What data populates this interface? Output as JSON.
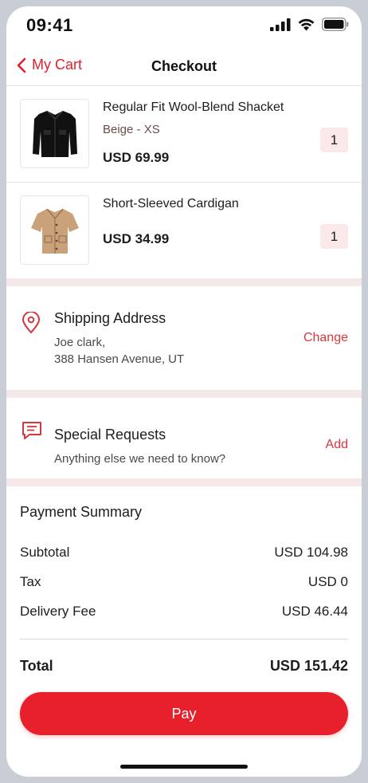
{
  "status_bar": {
    "time": "09:41",
    "icons": [
      "signal-icon",
      "wifi-icon",
      "battery-icon"
    ]
  },
  "nav": {
    "back_label": "My Cart",
    "title": "Checkout"
  },
  "items": [
    {
      "name": "Regular Fit Wool-Blend Shacket",
      "variant": "Beige - XS",
      "price": "USD 69.99",
      "qty": "1",
      "image": "black-jacket-image"
    },
    {
      "name": "Short-Sleeved Cardigan",
      "price": "USD 34.99",
      "qty": "1",
      "image": "beige-cardigan-image"
    }
  ],
  "shipping": {
    "icon": "location-pin-icon",
    "title": "Shipping Address",
    "line1": "Joe clark,",
    "line2": "388 Hansen Avenue, UT",
    "action": "Change"
  },
  "requests": {
    "icon": "message-icon",
    "title": "Special Requests",
    "placeholder": "Anything else we need to know?",
    "action": "Add"
  },
  "summary": {
    "title": "Payment Summary",
    "rows": [
      {
        "label": "Subtotal",
        "value": "USD 104.98"
      },
      {
        "label": "Tax",
        "value": "USD 0"
      },
      {
        "label": "Delivery Fee",
        "value": "USD 46.44"
      }
    ],
    "total_label": "Total",
    "total_value": "USD 151.42"
  },
  "pay_label": "Pay",
  "colors": {
    "accent": "#e8202b",
    "accent_light": "#fbe9e9",
    "band": "#f6e8e8"
  }
}
